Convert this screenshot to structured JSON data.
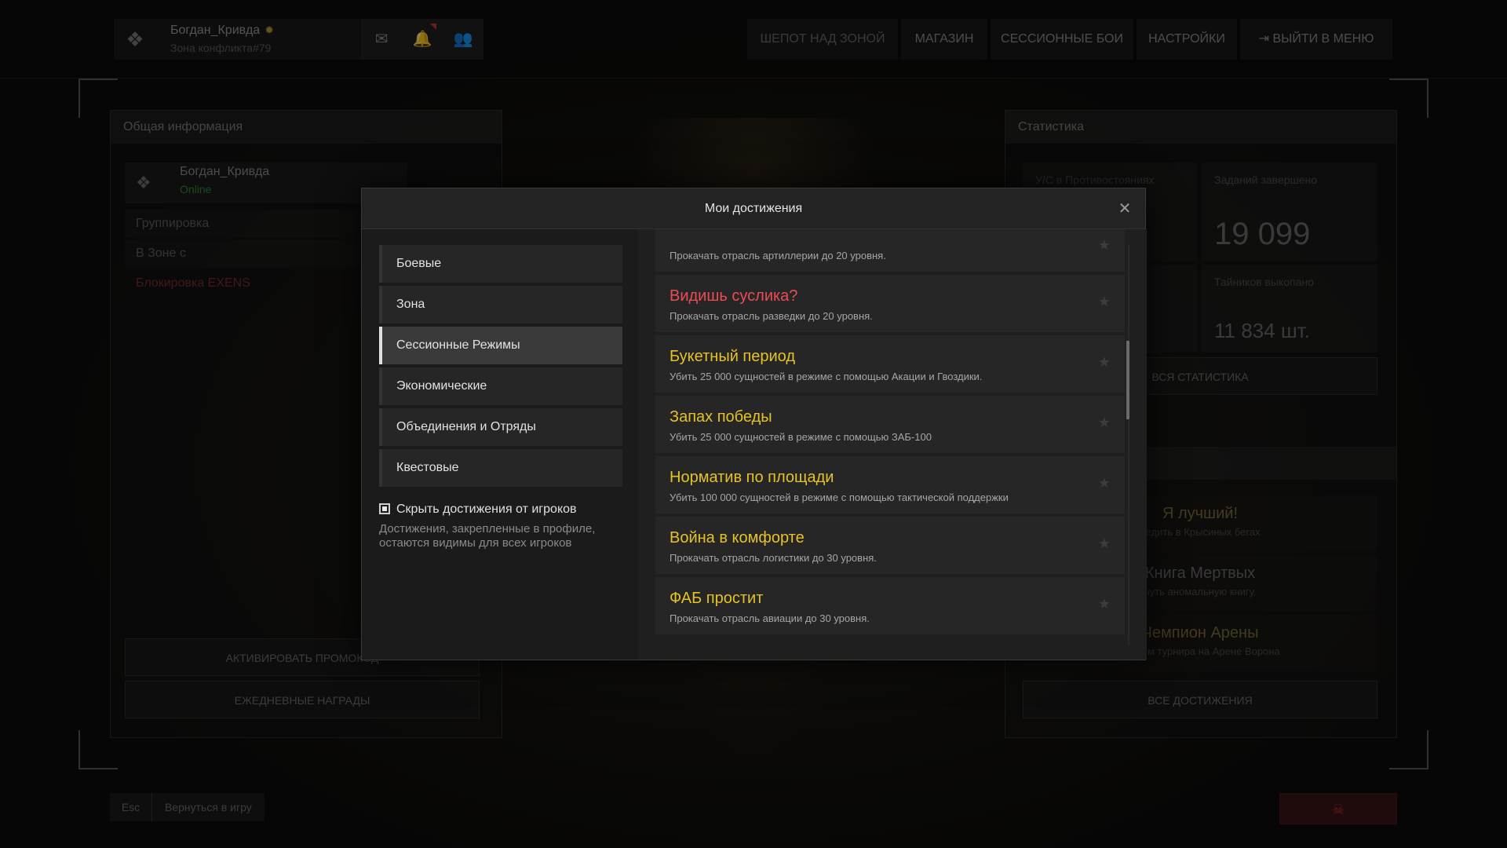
{
  "topbar": {
    "player_name": "Богдан_Кривда",
    "rank_icon": "rank-badge-icon",
    "zone": "Зона конфликта#79",
    "nav": [
      {
        "label": "Шепот над зоной"
      },
      {
        "label": "Магазин"
      },
      {
        "label": "Сессионные бои"
      },
      {
        "label": "Настройки"
      },
      {
        "label": "Выйти в меню"
      }
    ]
  },
  "left_panel": {
    "title": "Общая информация",
    "player_name": "Богдан_Кривда",
    "status": "Online",
    "rows": [
      "Группировка",
      "В Зоне с"
    ],
    "ban_text": "Блокировка EXENS",
    "buttons": [
      "Активировать промокод",
      "Ежедневные награды"
    ]
  },
  "right_panel": {
    "title": "Статистика",
    "stats": [
      {
        "label": "У/С в Противостояниях",
        "value": ""
      },
      {
        "label": "Заданий завершено",
        "value": "19 099"
      },
      {
        "label": "",
        "value": ""
      },
      {
        "label": "Тайников выкопано",
        "value": "11 834 шт."
      }
    ],
    "all_stats_button": "Вся статистика",
    "bg_achievements": [
      {
        "title": "Я лучший!",
        "desc": "редить в Крысиных бегах"
      },
      {
        "title": "Книга Мертвых",
        "desc": "нуть аномальную книгу."
      },
      {
        "title": "Чемпион Арены",
        "desc": "ителем турнира на Арене Ворона"
      }
    ],
    "all_achievements_button": "Все достижения"
  },
  "bottom": {
    "esc_key": "Esc",
    "esc_label": "Вернуться в игру",
    "kill_icon": "skull-icon"
  },
  "modal": {
    "title": "Мои достижения",
    "close_icon": "close-icon",
    "menu": [
      {
        "label": "Боевые",
        "active": false
      },
      {
        "label": "Зона",
        "active": false
      },
      {
        "label": "Сессионные Режимы",
        "active": true
      },
      {
        "label": "Экономические",
        "active": false
      },
      {
        "label": "Объединения и Отряды",
        "active": false
      },
      {
        "label": "Квестовые",
        "active": false
      }
    ],
    "hide_label": "Скрыть достижения от игроков",
    "hide_desc": "Достижения, закрепленные в профиле, остаются видимы для всех игроков",
    "achievements": [
      {
        "title": "",
        "desc": "Прокачать отрасль артиллерии до 20 уровня.",
        "color": "#e04848"
      },
      {
        "title": "Видишь суслика?",
        "desc": "Прокачать отрасль разведки до 20 уровня.",
        "color": "#ee4b55"
      },
      {
        "title": "Букетный период",
        "desc": "Убить 25 000 сущностей в режиме с помощью Акации и Гвоздики.",
        "color": "#e6c229"
      },
      {
        "title": "Запах победы",
        "desc": "Убить 25 000 сущностей в режиме с помощью ЗАБ-100",
        "color": "#e6c229"
      },
      {
        "title": "Норматив по площади",
        "desc": "Убить 100 000 сущностей в режиме с помощью тактической поддержки",
        "color": "#e6c229"
      },
      {
        "title": "Война в комфорте",
        "desc": "Прокачать отрасль логистики до 30 уровня.",
        "color": "#e6c229"
      },
      {
        "title": "ФАБ простит",
        "desc": "Прокачать отрасль авиации до 30 уровня.",
        "color": "#e6c229"
      }
    ]
  }
}
